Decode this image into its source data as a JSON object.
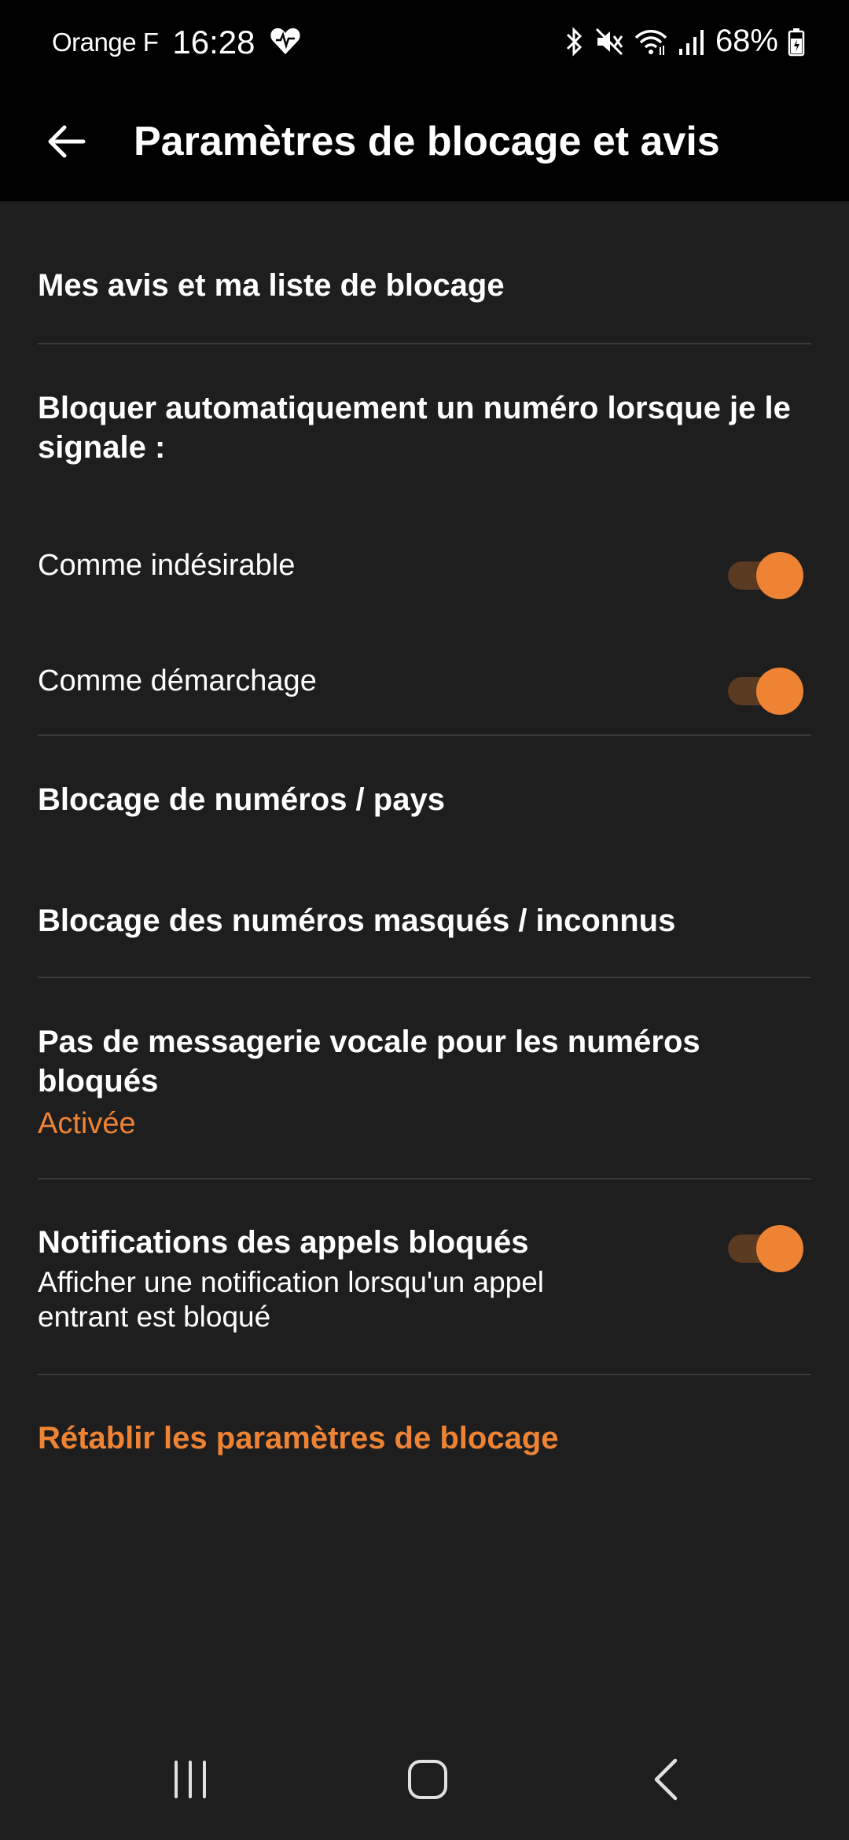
{
  "status_bar": {
    "carrier": "Orange F",
    "time": "16:28",
    "battery": "68%"
  },
  "app_bar": {
    "title": "Paramètres de blocage et avis"
  },
  "settings": {
    "my_reviews": "Mes avis et ma liste de blocage",
    "auto_block_header": "Bloquer automatiquement un numéro lorsque je le signale :",
    "as_spam": "Comme indésirable",
    "as_telemarketing": "Comme démarchage",
    "block_numbers_countries": "Blocage de numéros / pays",
    "block_hidden_unknown": "Blocage des numéros masqués / inconnus",
    "no_voicemail_title": "Pas de messagerie vocale pour les numéros bloqués",
    "no_voicemail_status": "Activée",
    "blocked_calls_notifications_title": "Notifications des appels bloqués",
    "blocked_calls_notifications_subtitle": "Afficher une notification lorsqu'un appel entrant est bloqué",
    "reset_blocking": "Rétablir les paramètres de blocage"
  },
  "toggles": {
    "as_spam": true,
    "as_telemarketing": true,
    "blocked_calls_notifications": true
  },
  "colors": {
    "accent": "#ee8334",
    "background": "#1e1e1f",
    "divider": "#3a3a3c"
  },
  "icons": {
    "back": "arrow-left-icon",
    "bluetooth": "bluetooth-icon",
    "mute": "mute-icon",
    "wifi": "wifi-icon",
    "signal": "signal-icon",
    "battery": "battery-icon",
    "nav_recents": "recents-icon",
    "nav_home": "home-icon",
    "nav_back": "chevron-left-icon"
  }
}
